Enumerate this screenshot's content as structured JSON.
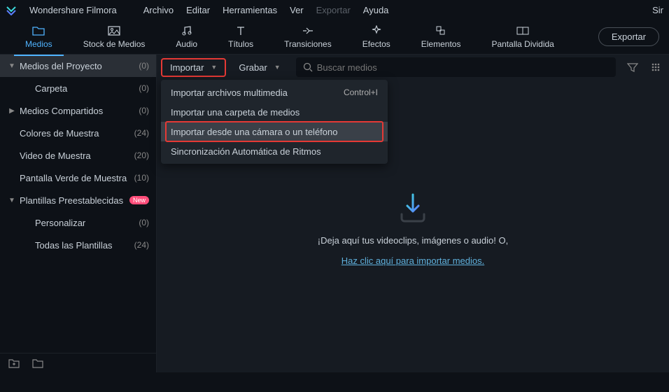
{
  "app": {
    "title": "Wondershare Filmora"
  },
  "menus": {
    "file": "Archivo",
    "edit": "Editar",
    "tools": "Herramientas",
    "view": "Ver",
    "export": "Exportar",
    "help": "Ayuda"
  },
  "titlebar_right": "Sir",
  "toolbar": {
    "media": "Medios",
    "stock": "Stock de Medios",
    "audio": "Audio",
    "titles": "Títulos",
    "transitions": "Transiciones",
    "effects": "Efectos",
    "elements": "Elementos",
    "split": "Pantalla Dividida",
    "export_btn": "Exportar"
  },
  "sidebar": {
    "items": [
      {
        "label": "Medios del Proyecto",
        "count": "(0)"
      },
      {
        "label": "Carpeta",
        "count": "(0)"
      },
      {
        "label": "Medios Compartidos",
        "count": "(0)"
      },
      {
        "label": "Colores de Muestra",
        "count": "(24)"
      },
      {
        "label": "Video de Muestra",
        "count": "(20)"
      },
      {
        "label": "Pantalla Verde de Muestra",
        "count": "(10)"
      },
      {
        "label": "Plantillas Preestablecidas",
        "count": ""
      },
      {
        "label": "Personalizar",
        "count": "(0)"
      },
      {
        "label": "Todas las Plantillas",
        "count": "(24)"
      }
    ],
    "new_badge": "New"
  },
  "content_bar": {
    "import": "Importar",
    "record": "Grabar",
    "search_placeholder": "Buscar medios"
  },
  "dropdown": {
    "import_files": "Importar archivos multimedia",
    "import_files_shortcut": "Control+I",
    "import_folder": "Importar una carpeta de medios",
    "import_device": "Importar desde una cámara o un teléfono",
    "auto_beat": "Sincronización Automática de Ritmos"
  },
  "drop": {
    "text": "¡Deja aquí tus videoclips, imágenes o audio! O,",
    "link": "Haz clic aquí para importar medios."
  }
}
